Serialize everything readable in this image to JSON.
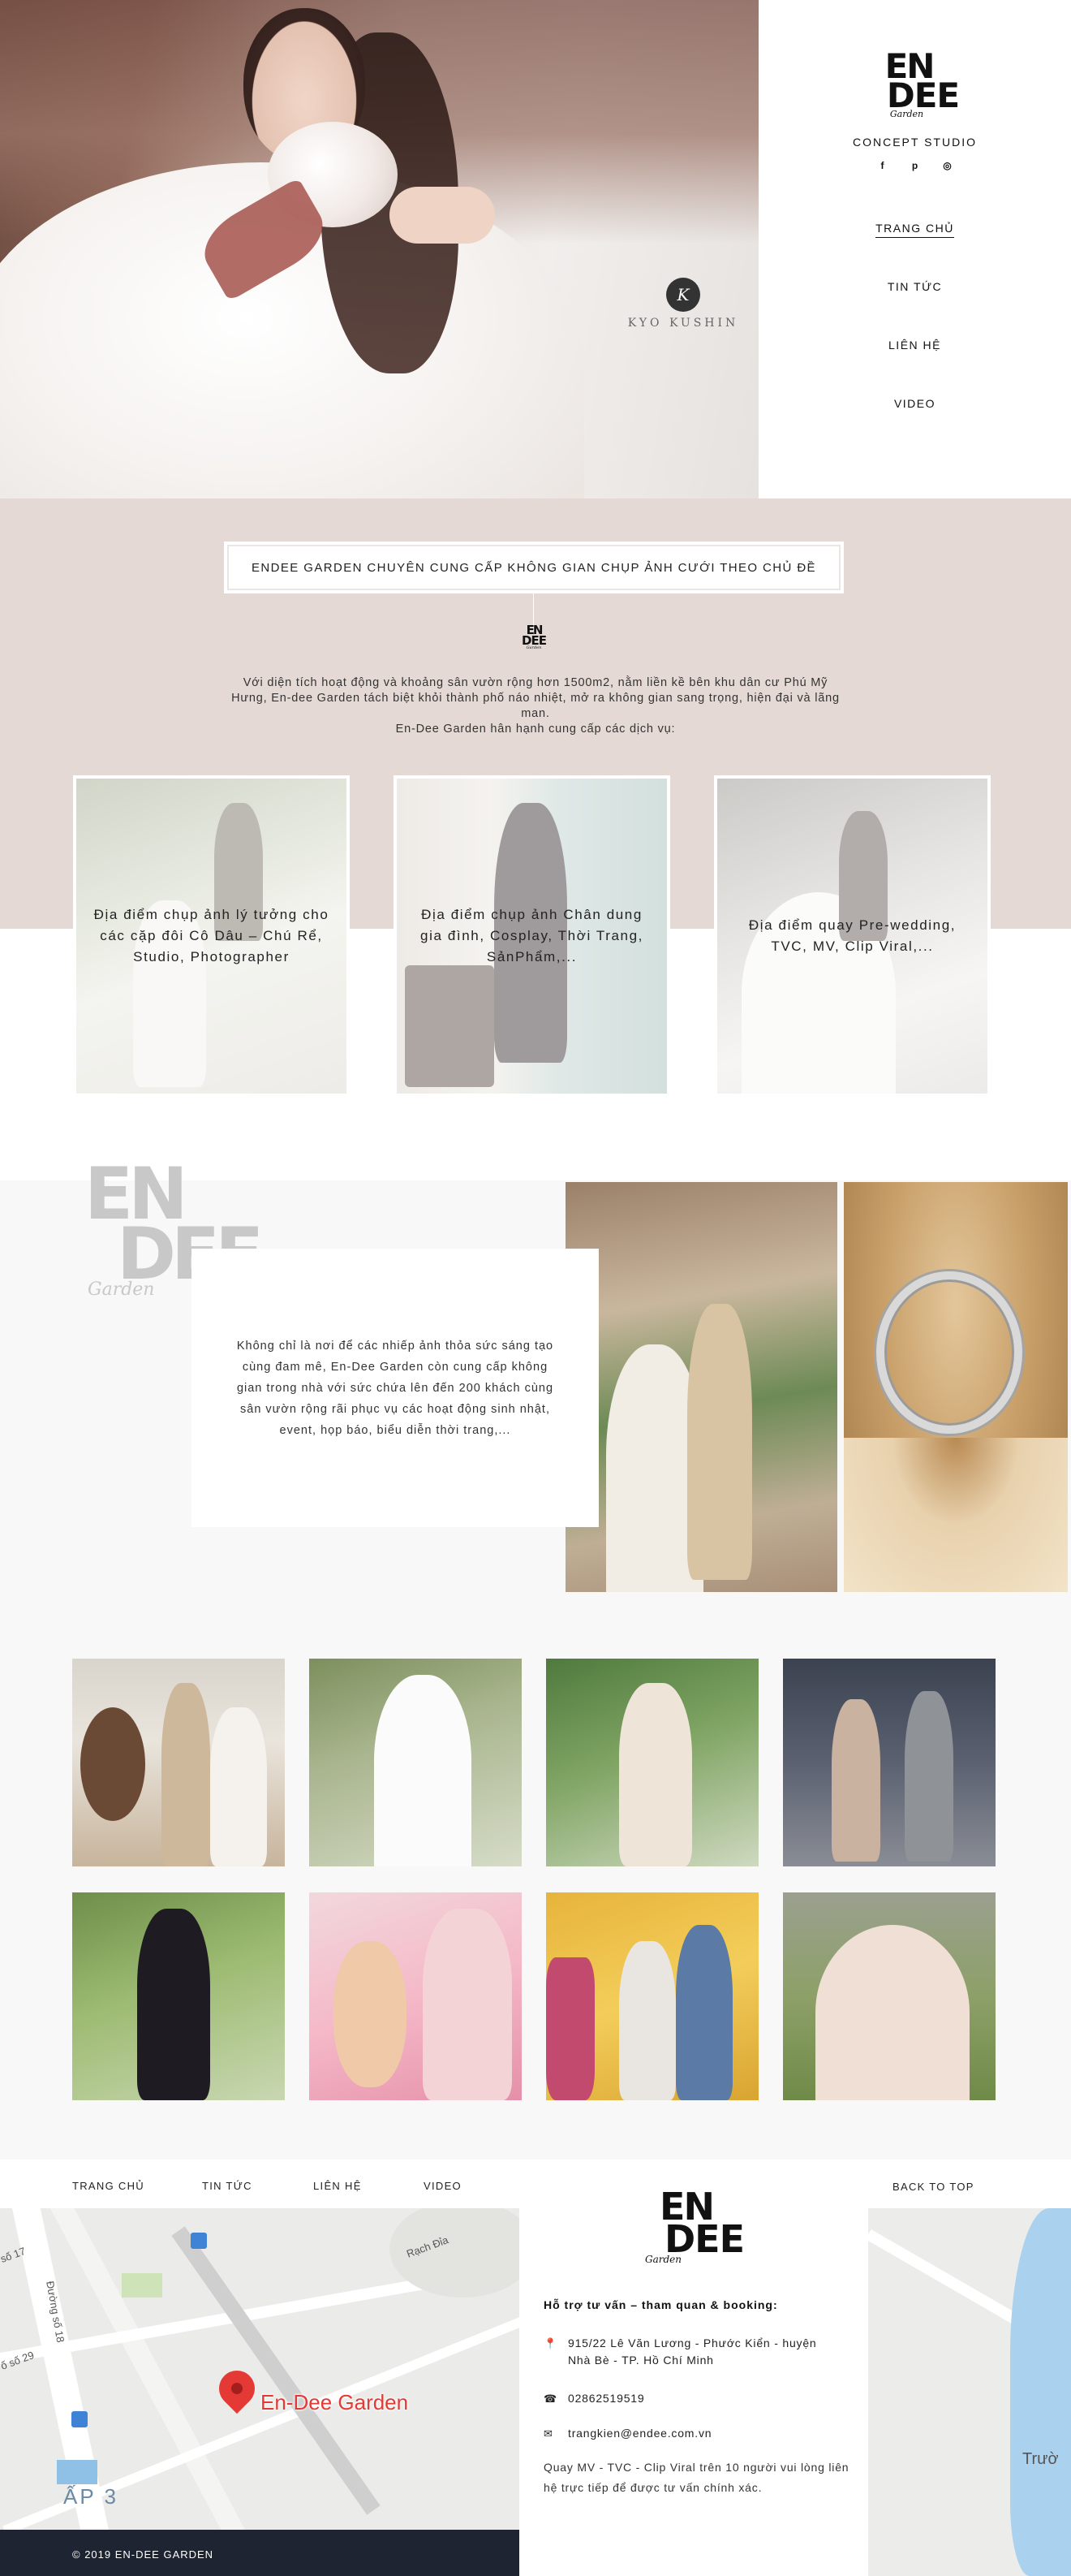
{
  "brand": {
    "logo_line1": "EN",
    "logo_line2": "DEE",
    "logo_line3": "Garden",
    "tagline": "CONCEPT STUDIO",
    "social": [
      "f",
      "p",
      "◎"
    ]
  },
  "hero": {
    "watermark_mark": "K",
    "watermark_text": "KYO KUSHIN"
  },
  "nav": {
    "items": [
      "TRANG CHỦ",
      "TIN TỨC",
      "LIÊN HỆ",
      "VIDEO"
    ],
    "active_index": 0
  },
  "intro": {
    "banner": "ENDEE GARDEN CHUYÊN CUNG CẤP KHÔNG GIAN CHỤP ẢNH CƯỚI THEO CHỦ ĐỀ",
    "paragraph_1": "Với diện tích hoạt động và khoảng sân vườn rộng hơn 1500m2, nằm liền kề bên khu dân cư Phú Mỹ Hưng, En-dee Garden tách biệt khỏi thành phố náo nhiệt, mở ra không gian sang trọng, hiện đại và lãng man.",
    "paragraph_2": "En-Dee Garden hân hạnh cung cấp các dịch vụ:"
  },
  "services": [
    {
      "label": "Địa điểm chụp ảnh lý tưởng cho các cặp đôi Cô Dâu – Chú Rể, Studio, Photographer"
    },
    {
      "label": "Địa điểm chụp ảnh Chân dung gia đình, Cosplay, Thời Trang, SảnPhẩm,..."
    },
    {
      "label": "Địa điểm quay Pre-wedding, TVC, MV, Clip Viral,..."
    }
  ],
  "about": {
    "text": "Không chỉ là nơi để các nhiếp ảnh thỏa sức sáng tạo cùng đam mê, En-Dee Garden còn cung cấp không gian trong nhà với sức chứa lên đến 200 khách cùng sân vườn rộng rãi phục vụ các hoạt động sinh nhật, event, họp báo, biểu diễn thời trang,..."
  },
  "gallery": {
    "count": 8
  },
  "footer": {
    "nav": [
      "TRANG CHỦ",
      "TIN TỨC",
      "LIÊN HỆ",
      "VIDEO"
    ],
    "back_to_top": "BACK TO TOP",
    "contact_title": "Hỗ trợ tư vấn – tham quan & booking:",
    "address": "915/22 Lê Văn Lương - Phước Kiển - huyện Nhà Bè - TP. Hồ Chí Minh",
    "phone": "02862519519",
    "email": "trangkien@endee.com.vn",
    "note": "Quay MV - TVC - Clip Viral trên 10 người vui lòng liên hệ trực tiếp để được tư vấn chính xác.",
    "copyright": "© 2019 EN-DEE GARDEN"
  },
  "map": {
    "pin_label": "En-Dee Garden",
    "labels": [
      "Rạch Đỉa",
      "Đường số 18",
      "số 17",
      "ố số 29",
      "ẤP 3",
      "Trườ"
    ]
  },
  "colors": {
    "intro_bg": "#e5d9d5",
    "footer_bar": "#1f2433",
    "pin": "#e53935",
    "water": "#aad2ee"
  }
}
